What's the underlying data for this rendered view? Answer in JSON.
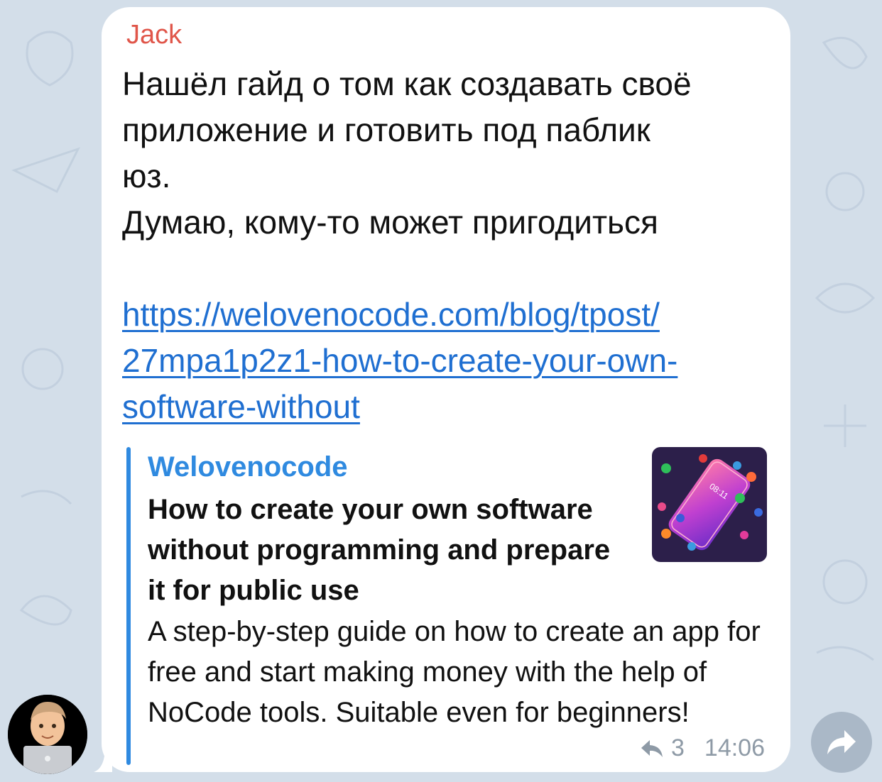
{
  "message": {
    "sender": "Jack",
    "text_lines": [
      "Нашёл гайд о том как создавать своё",
      "приложение и готовить под паблик",
      "юз.",
      "Думаю, кому-то может пригодиться"
    ],
    "link_lines": [
      "https://welovenocode.com/blog/tpost/",
      "27mpa1p2z1-how-to-create-your-own-",
      "software-without"
    ],
    "forwards": "3",
    "time": "14:06"
  },
  "preview": {
    "site": "Welovenocode",
    "title": "How to create your own software without programming and prepare it for public use",
    "description": "A step-by-step guide on how to create an app for free and start making money with the help of NoCode tools. Suitable even for beginners!",
    "thumbnail_time": "08:11"
  },
  "colors": {
    "background": "#d3dee9",
    "sender": "#e0564a",
    "link": "#1f6fd1",
    "accent": "#2f8ae0",
    "meta": "#8e9aa6"
  },
  "icons": [
    "reply-count-icon",
    "share-arrow-icon"
  ]
}
